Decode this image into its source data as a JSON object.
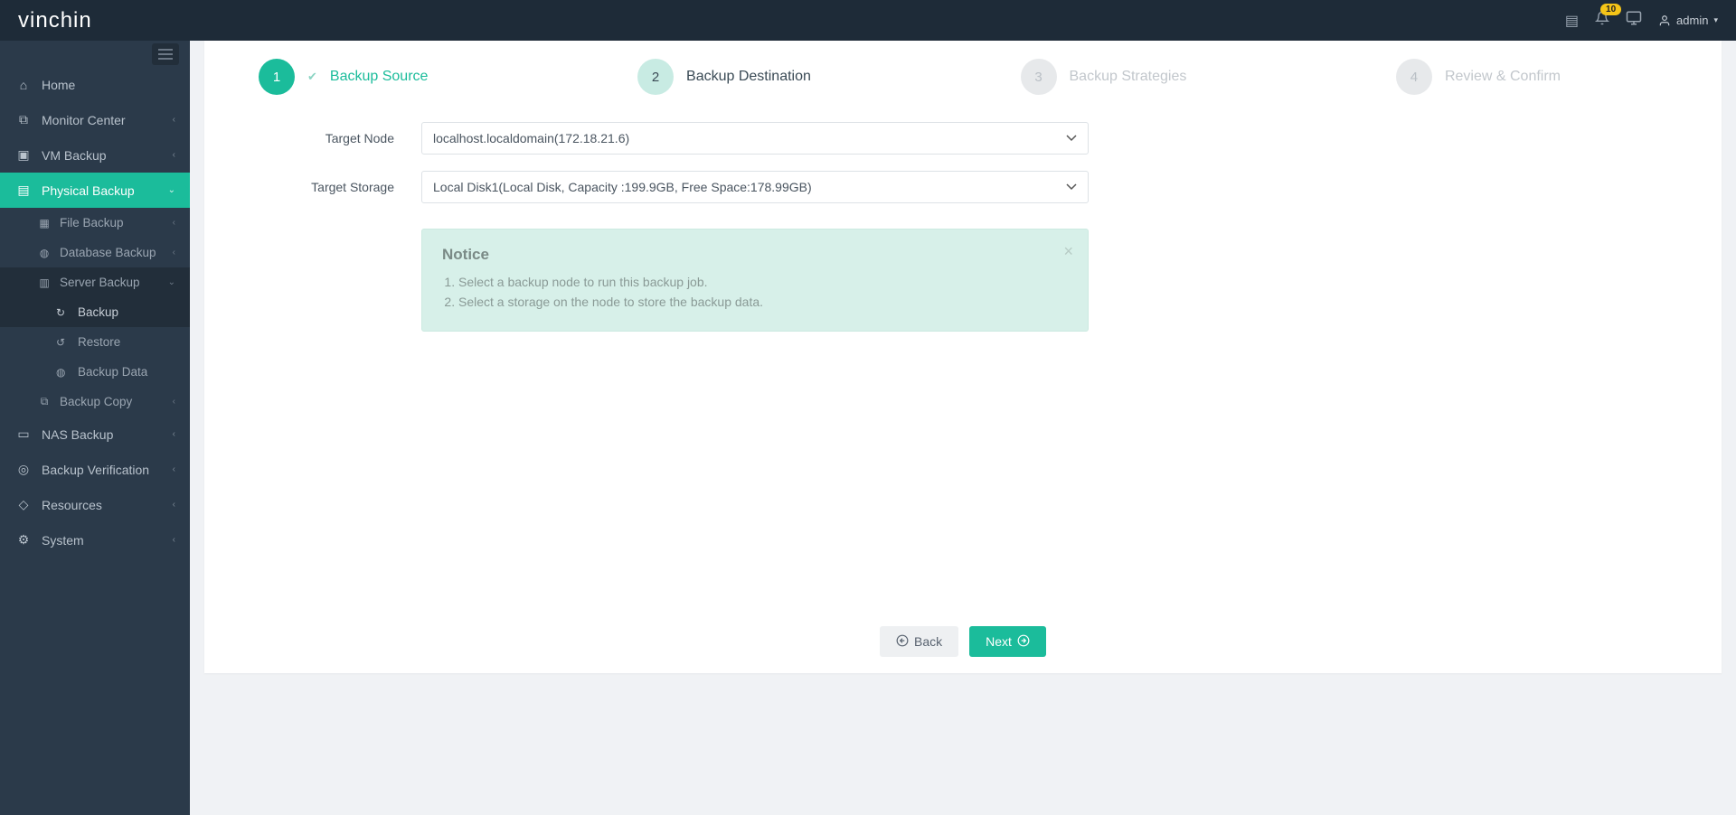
{
  "brand": {
    "name_a": "vin",
    "name_b": "chin"
  },
  "topbar": {
    "badge": "10",
    "user": "admin"
  },
  "sidebar": {
    "home": "Home",
    "monitor": "Monitor Center",
    "vm": "VM Backup",
    "physical": "Physical Backup",
    "file": "File Backup",
    "database": "Database Backup",
    "server": "Server Backup",
    "backup": "Backup",
    "restore": "Restore",
    "backup_data": "Backup Data",
    "backup_copy": "Backup Copy",
    "nas": "NAS Backup",
    "verification": "Backup Verification",
    "resources": "Resources",
    "system": "System"
  },
  "wizard": {
    "s1": {
      "num": "1",
      "label": "Backup Source"
    },
    "s2": {
      "num": "2",
      "label": "Backup Destination"
    },
    "s3": {
      "num": "3",
      "label": "Backup Strategies"
    },
    "s4": {
      "num": "4",
      "label": "Review & Confirm"
    }
  },
  "form": {
    "target_node_label": "Target Node",
    "target_node_value": "localhost.localdomain(172.18.21.6)",
    "target_storage_label": "Target Storage",
    "target_storage_value": "Local Disk1(Local Disk, Capacity :199.9GB, Free Space:178.99GB)"
  },
  "notice": {
    "title": "Notice",
    "line1": "Select a backup node to run this backup job.",
    "line2": "Select a storage on the node to store the backup data."
  },
  "buttons": {
    "back": "Back",
    "next": "Next"
  }
}
